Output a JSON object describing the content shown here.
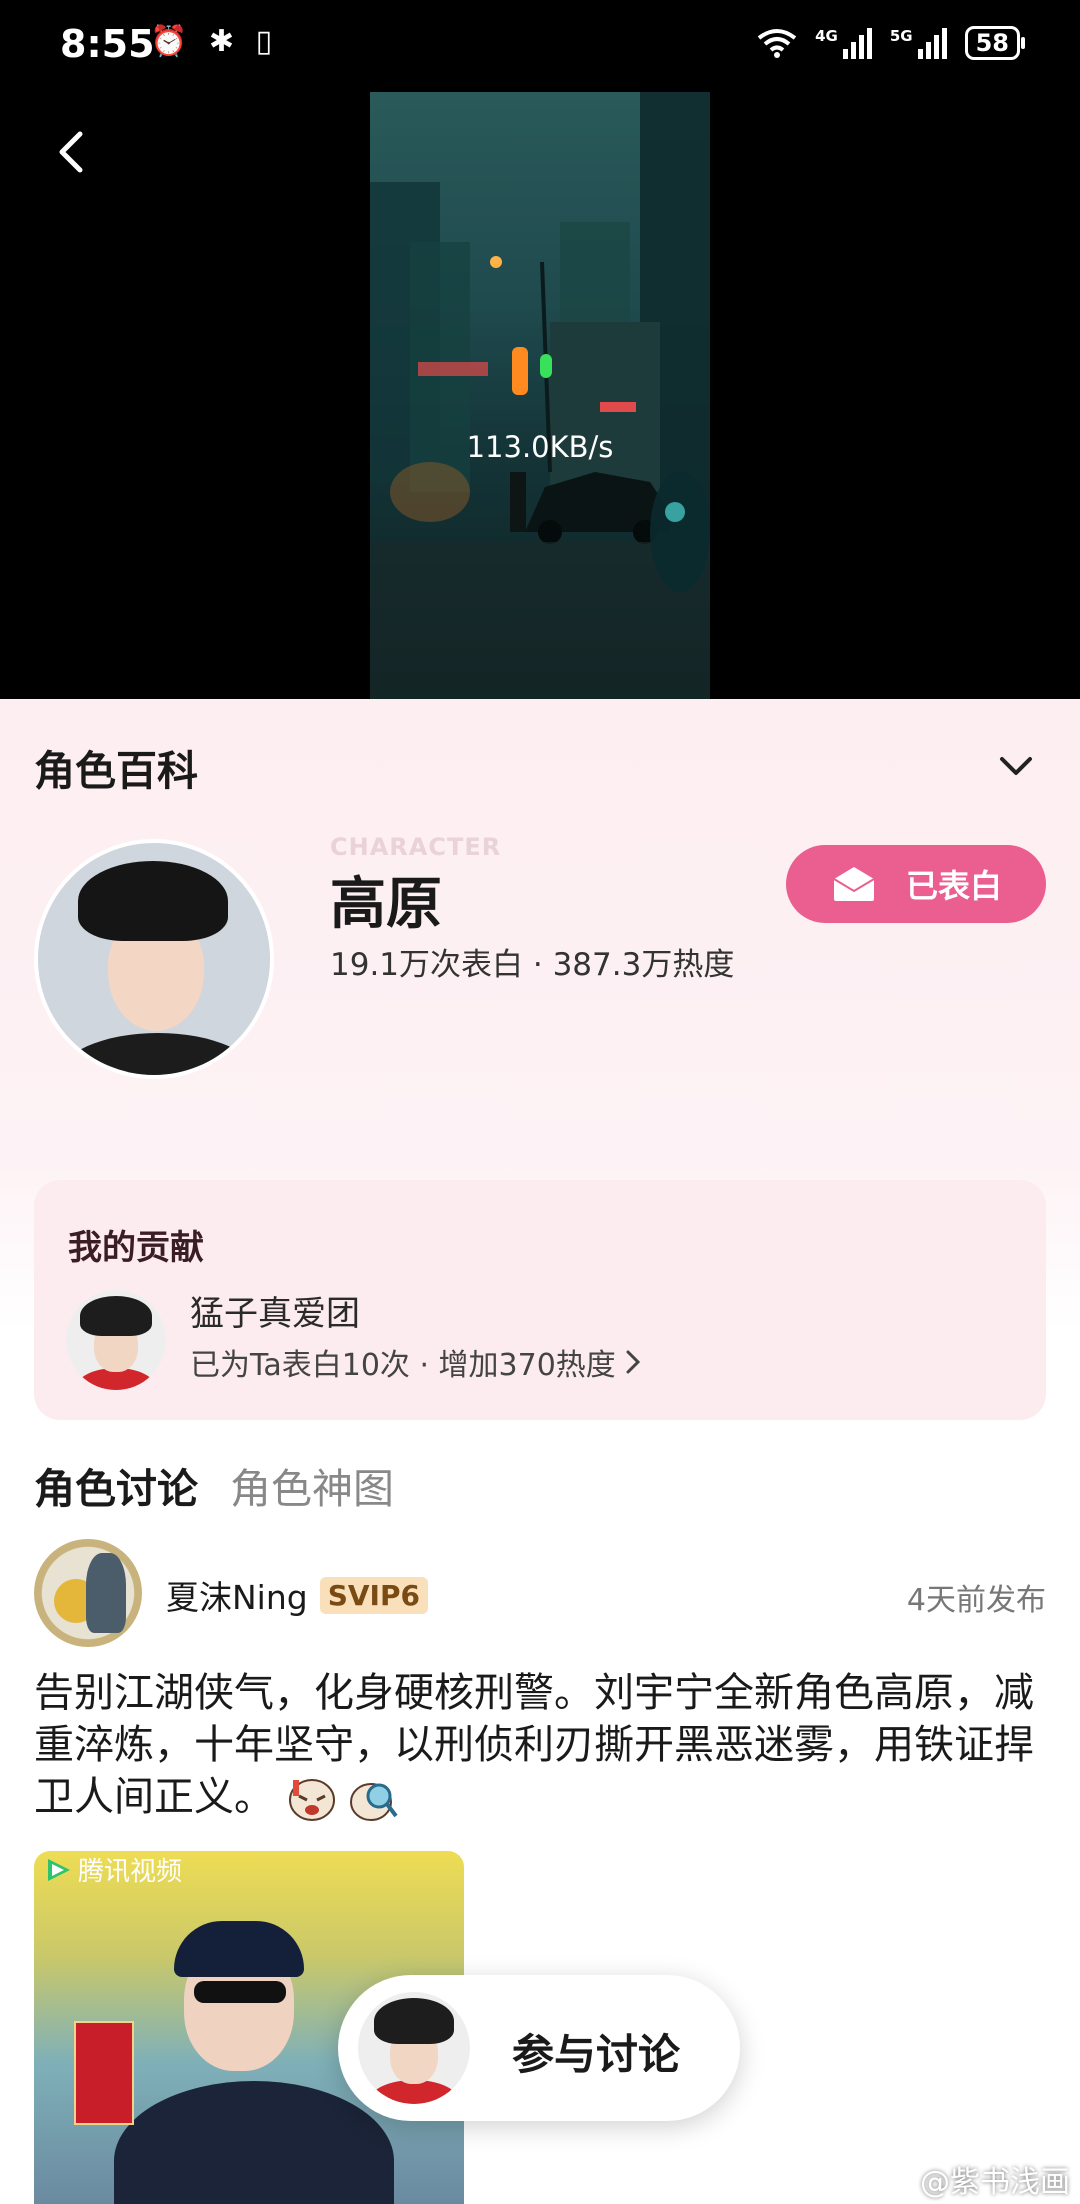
{
  "status_bar": {
    "time": "8:55",
    "left_icons": "⏰ ✱ ▯",
    "network_4g": "4G",
    "network_5g": "5G",
    "battery": "58"
  },
  "video": {
    "speed": "113.0KB/s"
  },
  "wiki": {
    "title": "角色百科",
    "character_tag": "CHARACTER",
    "name": "高原",
    "stats": "19.1万次表白 · 387.3万热度",
    "confess_button": "已表白"
  },
  "contribution": {
    "title": "我的贡献",
    "group_name": "猛子真爱团",
    "detail": "已为Ta表白10次 · 增加370热度"
  },
  "tabs": [
    {
      "label": "角色讨论",
      "active": true
    },
    {
      "label": "角色神图",
      "active": false
    }
  ],
  "post": {
    "username": "夏沫Ning",
    "badge": "SVIP6",
    "time": "4天前发布",
    "text": "告别江湖侠气，化身硬核刑警。刘宇宁全新角色高原，减重淬炼，十年坚守，以刑侦利刃撕开黑恶迷雾，用铁证捍卫人间正义。",
    "image_logo": "腾讯视频"
  },
  "discuss_button": "参与讨论",
  "watermark": "@紫书浅画",
  "colors": {
    "accent": "#ea5f8f",
    "panel_bg": "#fdeef1",
    "contrib_bg": "#fcecf0"
  }
}
